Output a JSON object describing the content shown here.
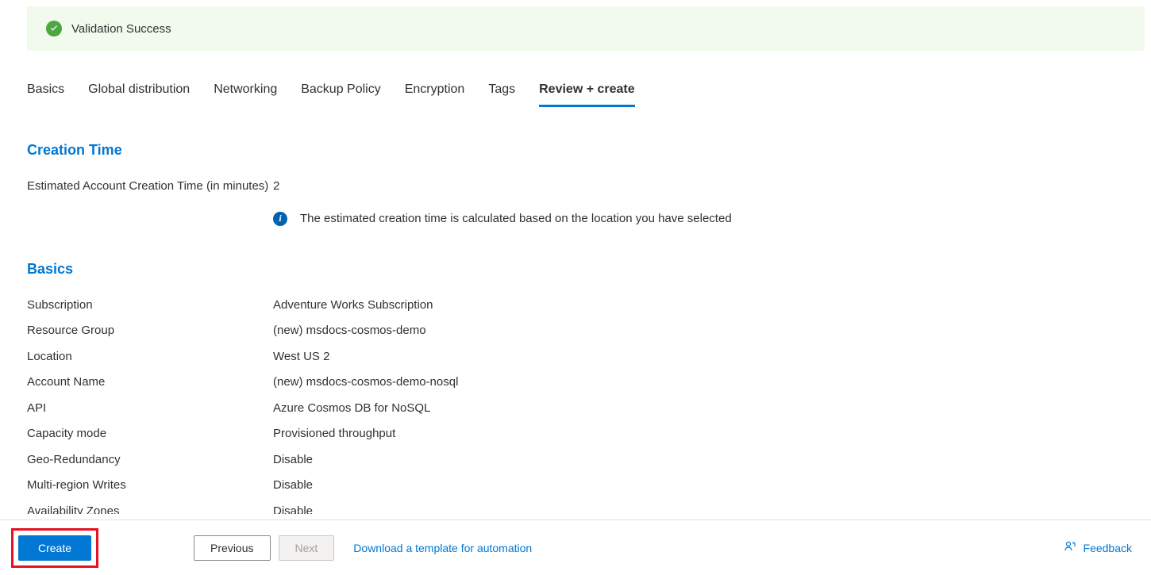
{
  "banner": {
    "text": "Validation Success"
  },
  "tabs": [
    {
      "label": "Basics",
      "active": false
    },
    {
      "label": "Global distribution",
      "active": false
    },
    {
      "label": "Networking",
      "active": false
    },
    {
      "label": "Backup Policy",
      "active": false
    },
    {
      "label": "Encryption",
      "active": false
    },
    {
      "label": "Tags",
      "active": false
    },
    {
      "label": "Review + create",
      "active": true
    }
  ],
  "sections": {
    "creation_time": {
      "heading": "Creation Time",
      "estimate_label": "Estimated Account Creation Time (in minutes)",
      "estimate_value": "2",
      "info_text": "The estimated creation time is calculated based on the location you have selected"
    },
    "basics": {
      "heading": "Basics",
      "rows": [
        {
          "label": "Subscription",
          "value": "Adventure Works Subscription"
        },
        {
          "label": "Resource Group",
          "value": "(new) msdocs-cosmos-demo"
        },
        {
          "label": "Location",
          "value": "West US 2"
        },
        {
          "label": "Account Name",
          "value": "(new) msdocs-cosmos-demo-nosql"
        },
        {
          "label": "API",
          "value": "Azure Cosmos DB for NoSQL"
        },
        {
          "label": "Capacity mode",
          "value": "Provisioned throughput"
        },
        {
          "label": "Geo-Redundancy",
          "value": "Disable"
        },
        {
          "label": "Multi-region Writes",
          "value": "Disable"
        },
        {
          "label": "Availability Zones",
          "value": "Disable"
        }
      ]
    }
  },
  "footer": {
    "create": "Create",
    "previous": "Previous",
    "next": "Next",
    "download": "Download a template for automation",
    "feedback": "Feedback"
  }
}
